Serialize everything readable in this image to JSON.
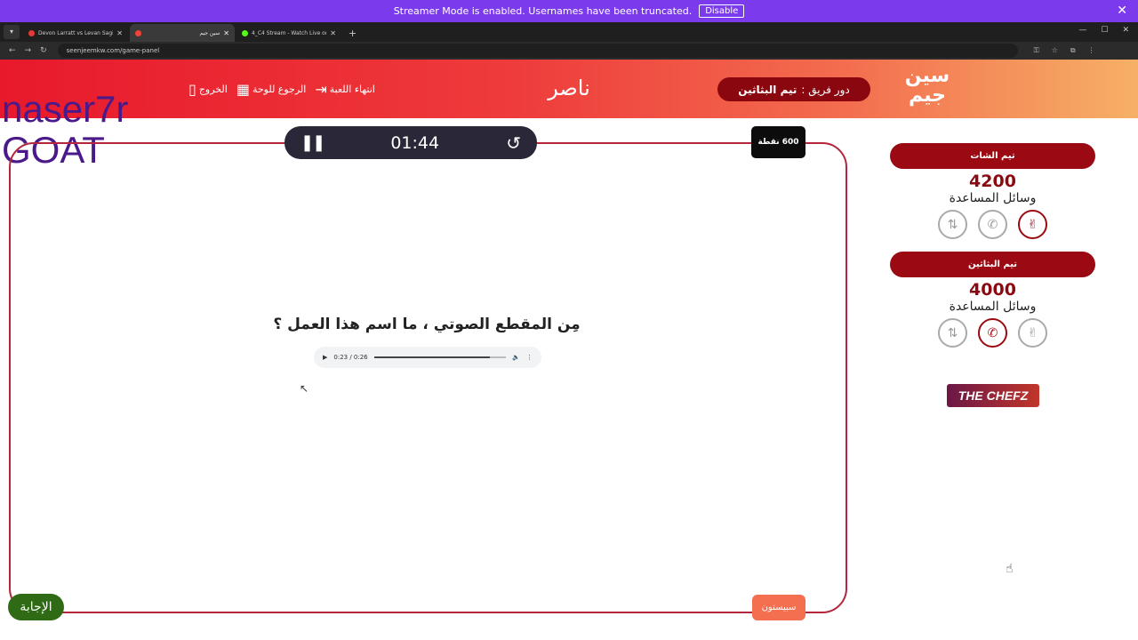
{
  "banner": {
    "text": "Streamer Mode is enabled. Usernames have been truncated.",
    "disable_label": "Disable",
    "close_icon": "close-icon"
  },
  "browser": {
    "tabs": [
      {
        "label": "Devon Larratt vs Levan Saginas...",
        "favicon_color": "#e53935",
        "active": false
      },
      {
        "label": "سين جيم",
        "favicon_color": "#f44336",
        "active": true
      },
      {
        "label": "4_C4 Stream - Watch Live on Ki...",
        "favicon_color": "#53fc18",
        "active": false
      }
    ],
    "url": "seenjeemkw.com/game-panel"
  },
  "header": {
    "logo_text": "سين جيم",
    "turn_prefix": "دور فريق :",
    "turn_team": "تيم البثاثين",
    "player_name": "ناصر",
    "actions": {
      "end_game": "انتهاء اللعبة",
      "back_to_board": "الرجوع للوحة",
      "exit": "الخروج"
    }
  },
  "overlay": {
    "line1": "naser7r",
    "line2": "GOAT"
  },
  "board": {
    "timer": "01:44",
    "points": "600 نقطة",
    "question": "مِن المقطع الصوتي ، ما اسم هذا العمل ؟",
    "audio": {
      "time": "0:23 / 0:26",
      "progress": 0.88
    },
    "answer_label": "الإجابة",
    "category_label": "سبيستون"
  },
  "teams": [
    {
      "name": "تيم الشات",
      "score": "4200",
      "aids_label": "وسائل المساعدة",
      "aids": [
        {
          "icon": "swap-icon",
          "used": false
        },
        {
          "icon": "phone-icon",
          "used": false
        },
        {
          "icon": "victory-hand-icon",
          "used": true
        }
      ]
    },
    {
      "name": "تيم البثاثين",
      "score": "4000",
      "aids_label": "وسائل المساعدة",
      "aids": [
        {
          "icon": "swap-icon",
          "used": false
        },
        {
          "icon": "phone-icon",
          "used": true
        },
        {
          "icon": "victory-hand-icon",
          "used": false
        }
      ]
    }
  ],
  "sponsor": "THE CHEFZ",
  "colors": {
    "accent": "#9b0a12",
    "header_start": "#e8192c",
    "header_end": "#f6b066",
    "answer_button": "#2e6b14",
    "category_button": "#f36f4f"
  }
}
